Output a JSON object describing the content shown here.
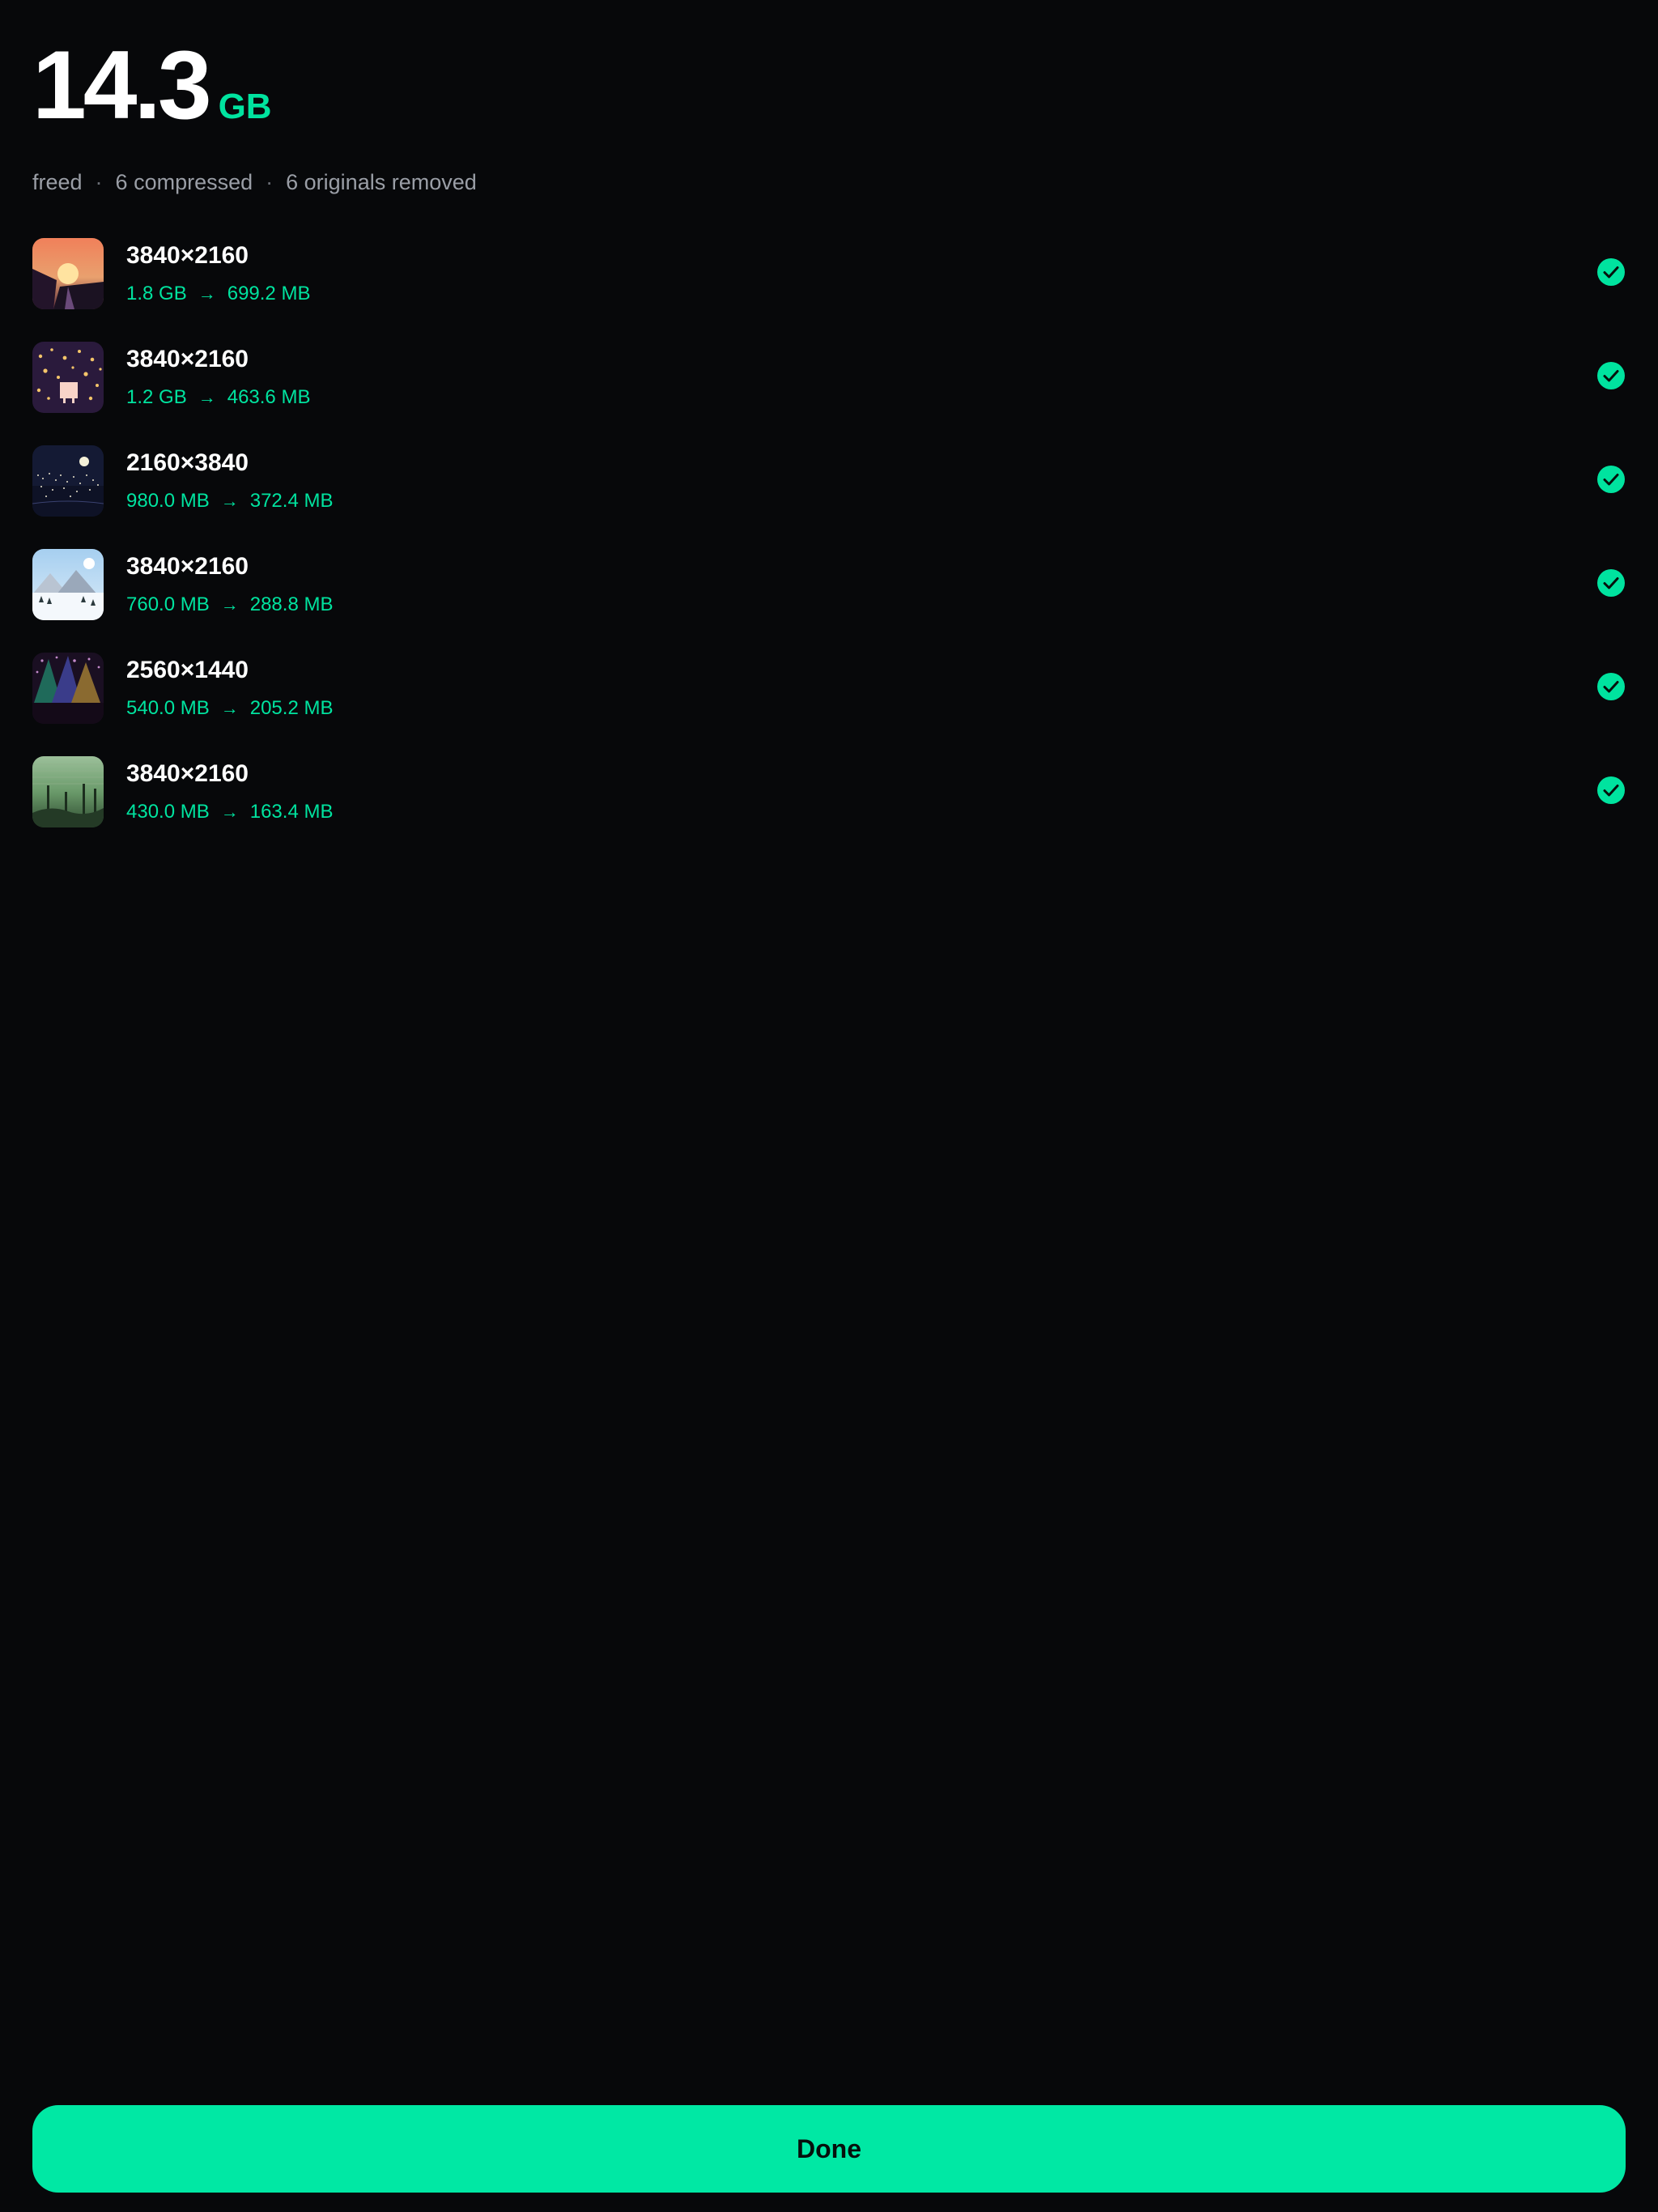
{
  "summary": {
    "total_value": "14.3",
    "total_unit": "GB",
    "freed_label": "freed",
    "compressed_label": "6 compressed",
    "removed_label": "6 originals removed",
    "separator": "·"
  },
  "files": [
    {
      "resolution": "3840×2160",
      "original_size": "1.8 GB",
      "compressed_size": "699.2 MB",
      "thumbnail": "sunset-cliff-thumbnail",
      "status_icon": "check-circle-icon"
    },
    {
      "resolution": "3840×2160",
      "original_size": "1.2 GB",
      "compressed_size": "463.6 MB",
      "thumbnail": "night-lanterns-thumbnail",
      "status_icon": "check-circle-icon"
    },
    {
      "resolution": "2160×3840",
      "original_size": "980.0 MB",
      "compressed_size": "372.4 MB",
      "thumbnail": "night-city-moon-thumbnail",
      "status_icon": "check-circle-icon"
    },
    {
      "resolution": "3840×2160",
      "original_size": "760.0 MB",
      "compressed_size": "288.8 MB",
      "thumbnail": "snowy-mountains-thumbnail",
      "status_icon": "check-circle-icon"
    },
    {
      "resolution": "2560×1440",
      "original_size": "540.0 MB",
      "compressed_size": "205.2 MB",
      "thumbnail": "colorful-trees-thumbnail",
      "status_icon": "check-circle-icon"
    },
    {
      "resolution": "3840×2160",
      "original_size": "430.0 MB",
      "compressed_size": "163.4 MB",
      "thumbnail": "green-forest-thumbnail",
      "status_icon": "check-circle-icon"
    }
  ],
  "arrow_glyph": "→",
  "done_button": {
    "label": "Done"
  },
  "colors": {
    "background": "#07080a",
    "accent": "#00e8a4",
    "secondary_text": "#9a9ea6"
  }
}
